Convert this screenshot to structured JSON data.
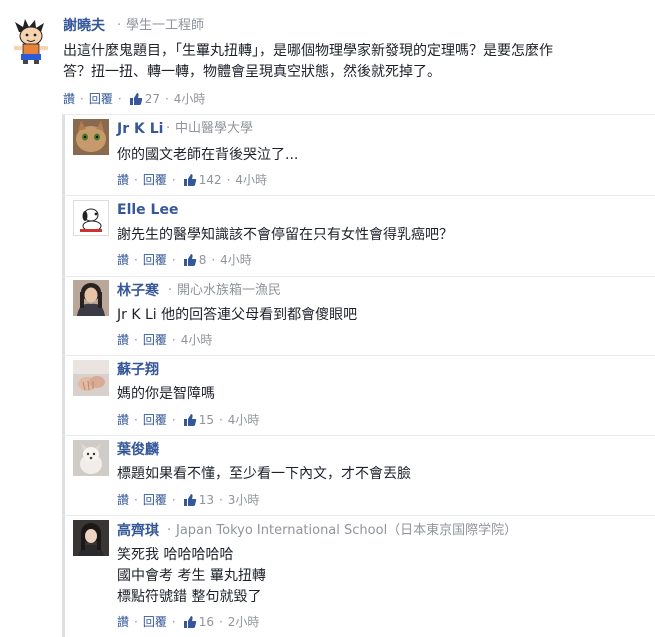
{
  "comments": [
    {
      "name": "謝曉夫",
      "meta": "學生一工程師",
      "lines": [
        "出這什麼鬼題目，「生罼丸扭轉」，是哪個物理學家新發現的定理嗎？是要怎麼作",
        "答？扭一扭、轉一轉，物體會呈現真空狀態，然後就死掉了。"
      ],
      "like_label": "讚",
      "reply_label": "回覆",
      "likes": "27",
      "time": "4小時",
      "avatar_icon": "cartoon-avatar"
    },
    {
      "name": "Jr K Li",
      "meta": "中山醫學大學",
      "lines": [
        "你的國文老師在背後哭泣了..."
      ],
      "like_label": "讚",
      "reply_label": "回覆",
      "likes": "142",
      "time": "4小時",
      "avatar_icon": "cat-avatar"
    },
    {
      "name": "Elle Lee",
      "meta": "",
      "lines": [
        "謝先生的醫學知識該不會停留在只有女性會得乳癌吧？"
      ],
      "like_label": "讚",
      "reply_label": "回覆",
      "likes": "8",
      "time": "4小時",
      "avatar_icon": "snoopy-avatar"
    },
    {
      "name": "林子寒",
      "meta": "開心水族箱一漁民",
      "lines": [
        "Jr K Li 他的回答連父母看到都會傻眼吧"
      ],
      "like_label": "讚",
      "reply_label": "回覆",
      "likes": "",
      "time": "4小時",
      "avatar_icon": "woman-avatar"
    },
    {
      "name": "蘇子翔",
      "meta": "",
      "lines": [
        "媽的你是智障嗎"
      ],
      "like_label": "讚",
      "reply_label": "回覆",
      "likes": "15",
      "time": "4小時",
      "avatar_icon": "hands-avatar"
    },
    {
      "name": "葉俊麟",
      "meta": "",
      "lines": [
        "標題如果看不懂，至少看一下內文，才不會丟臉"
      ],
      "like_label": "讚",
      "reply_label": "回覆",
      "likes": "13",
      "time": "3小時",
      "avatar_icon": "dog-avatar"
    },
    {
      "name": "高齊琪",
      "meta": "Japan Tokyo International School（日本東京国際学院）",
      "lines": [
        "笑死我 哈哈哈哈哈",
        "國中會考 考生 罼丸扭轉",
        "標點符號錯 整句就毀了"
      ],
      "like_label": "讚",
      "reply_label": "回覆",
      "likes": "16",
      "time": "2小時",
      "avatar_icon": "girl-avatar"
    }
  ],
  "colors": {
    "link": "#365899",
    "meta": "#90949c",
    "text": "#1d2129"
  }
}
